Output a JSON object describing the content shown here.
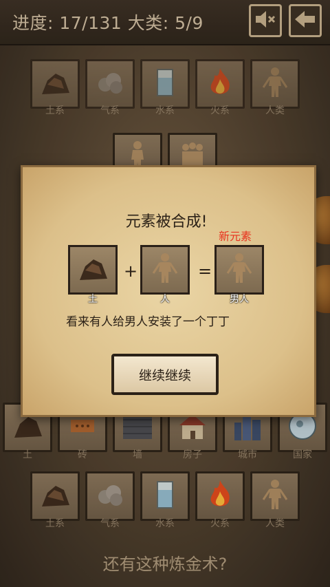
{
  "header": {
    "progress": "进度: 17/131 大类: 5/9"
  },
  "top_row": [
    {
      "label": "土系",
      "icon": "rock-icon"
    },
    {
      "label": "气系",
      "icon": "cloud-icon"
    },
    {
      "label": "水系",
      "icon": "water-glass-icon"
    },
    {
      "label": "火系",
      "icon": "fire-icon"
    },
    {
      "label": "人类",
      "icon": "human-icon"
    }
  ],
  "second_row": [
    {
      "label": "",
      "icon": "human-icon"
    },
    {
      "label": "",
      "icon": "people-icon"
    }
  ],
  "modal": {
    "title": "元素被合成!",
    "new_tag": "新元素",
    "recipe": [
      {
        "label": "土",
        "icon": "rock-icon"
      },
      {
        "label": "人",
        "icon": "human-icon"
      },
      {
        "label": "男人",
        "icon": "man-icon"
      }
    ],
    "plus": "+",
    "equals": "=",
    "description": "看来有人给男人安装了一个丁丁",
    "continue_label": "继续继续"
  },
  "third_row": [
    {
      "label": "土",
      "icon": "rock-icon"
    },
    {
      "label": "砖",
      "icon": "brick-icon"
    },
    {
      "label": "墙",
      "icon": "wall-icon"
    },
    {
      "label": "房子",
      "icon": "house-icon"
    },
    {
      "label": "城市",
      "icon": "city-icon"
    },
    {
      "label": "国家",
      "icon": "globe-icon"
    }
  ],
  "bottom_row": [
    {
      "label": "土系",
      "icon": "rock-icon"
    },
    {
      "label": "气系",
      "icon": "cloud-icon"
    },
    {
      "label": "水系",
      "icon": "water-glass-icon"
    },
    {
      "label": "火系",
      "icon": "fire-icon"
    },
    {
      "label": "人类",
      "icon": "human-icon"
    }
  ],
  "footer": {
    "text": "还有这种炼金术?"
  }
}
